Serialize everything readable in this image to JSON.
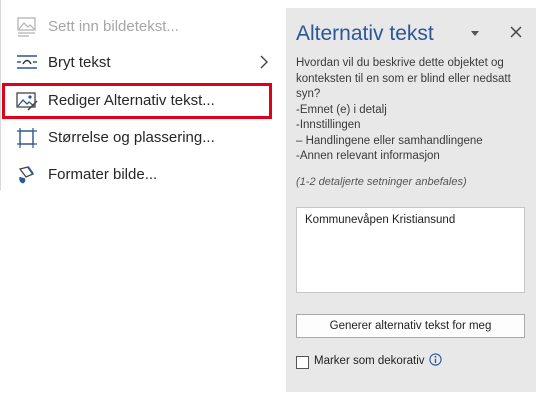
{
  "context_menu": {
    "items": [
      {
        "label": "Sett inn bildetekst...",
        "icon": "insert-caption-icon",
        "disabled": true
      },
      {
        "label": "Bryt tekst",
        "icon": "wrap-text-icon",
        "submenu": true
      },
      {
        "label": "Rediger Alternativ tekst...",
        "icon": "edit-alt-text-icon",
        "highlighted": true
      },
      {
        "label": "Størrelse og plassering...",
        "icon": "size-position-icon"
      },
      {
        "label": "Formater bilde...",
        "icon": "format-picture-icon"
      }
    ],
    "highlight_color": "#e0001a"
  },
  "alt_text_pane": {
    "title": "Alternativ tekst",
    "description_lines": [
      "Hvordan vil du beskrive dette objektet og",
      "konteksten til en som er blind eller nedsatt",
      "syn?",
      "-Emnet (e) i detalj",
      "-Innstillingen",
      "– Handlingene eller samhandlingene",
      "-Annen relevant informasjon"
    ],
    "hint": "(1-2 detaljerte setninger anbefales)",
    "alt_text_value": "Kommunevåpen Kristiansund",
    "generate_button": "Generer alternativ tekst for meg",
    "decorative_label": "Marker som dekorativ",
    "decorative_checked": false,
    "title_color": "#2b579a"
  }
}
